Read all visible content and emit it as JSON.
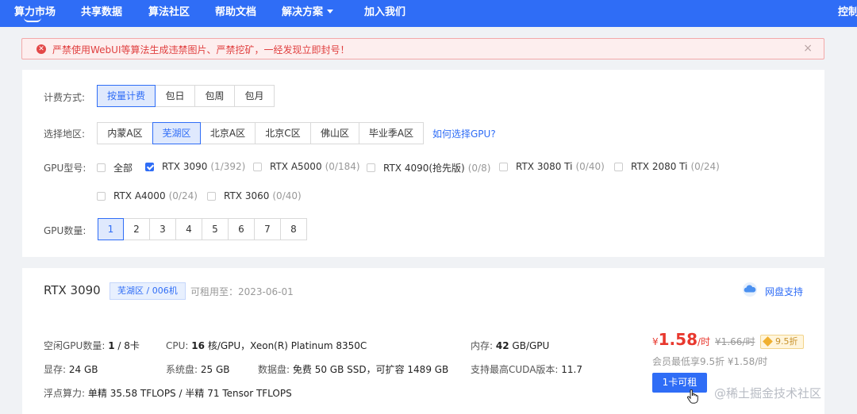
{
  "nav": {
    "items": [
      "算力市场",
      "共享数据",
      "算法社区",
      "帮助文档",
      "解决方案",
      "加入我们"
    ],
    "right": "控制"
  },
  "alert": {
    "text": "严禁使用WebUI等算法生成违禁图片、严禁挖矿，一经发现立即封号！",
    "close": "×"
  },
  "filters": {
    "billing": {
      "label": "计费方式:",
      "options": [
        "按量计费",
        "包日",
        "包周",
        "包月"
      ],
      "selected": "按量计费"
    },
    "region": {
      "label": "选择地区:",
      "options": [
        "内蒙A区",
        "芜湖区",
        "北京A区",
        "北京C区",
        "佛山区",
        "毕业季A区"
      ],
      "selected": "芜湖区",
      "help_link": "如何选择GPU?"
    },
    "gpu_model": {
      "label": "GPU型号:",
      "options": [
        {
          "name": "全部",
          "count": "",
          "checked": false
        },
        {
          "name": "RTX 3090",
          "count": "(1/392)",
          "checked": true
        },
        {
          "name": "RTX A5000",
          "count": "(0/184)",
          "checked": false
        },
        {
          "name": "RTX 4090(抢先版)",
          "count": "(0/8)",
          "checked": false
        },
        {
          "name": "RTX 3080 Ti",
          "count": "(0/40)",
          "checked": false
        },
        {
          "name": "RTX 2080 Ti",
          "count": "(0/24)",
          "checked": false
        },
        {
          "name": "RTX A4000",
          "count": "(0/24)",
          "checked": false
        },
        {
          "name": "RTX 3060",
          "count": "(0/40)",
          "checked": false
        }
      ]
    },
    "gpu_count": {
      "label": "GPU数量:",
      "options": [
        "1",
        "2",
        "3",
        "4",
        "5",
        "6",
        "7",
        "8"
      ],
      "selected": "1"
    }
  },
  "card": {
    "title": "RTX 3090",
    "region_tag": "芜湖区 / 006机",
    "available_until": "可租用至：2023-06-01",
    "cloud_disk": "网盘支持",
    "specs": {
      "idle_gpu": {
        "label": "空闲GPU数量:",
        "value": "1",
        "total": "/ 8卡"
      },
      "cpu": {
        "label": "CPU:",
        "value": "16",
        "rest": "核/GPU，Xeon(R) Platinum 8350C"
      },
      "memory": {
        "label": "内存:",
        "value": "42",
        "rest": "GB/GPU"
      },
      "vram": {
        "label": "显存:",
        "value": "24 GB"
      },
      "system_disk": {
        "label": "系统盘:",
        "value": "25 GB"
      },
      "data_disk": {
        "label": "数据盘:",
        "value": "免费 50 GB SSD，可扩容 1489 GB"
      },
      "cuda": {
        "label": "支持最高CUDA版本:",
        "value": "11.7"
      },
      "flops": {
        "label": "浮点算力:",
        "single_label": "单精",
        "single": "35.58 TFLOPS",
        "sep": "/",
        "half_label": "半精",
        "half": "71 Tensor TFLOPS"
      }
    },
    "price": {
      "currency": "¥",
      "value": "1.58",
      "unit": "/时",
      "original": "¥1.66/时",
      "discount": "9.5折",
      "member": "会员最低享9.5折 ¥1.58/时",
      "rent_button": "1卡可租"
    }
  },
  "watermark": "@稀土掘金技术社区"
}
